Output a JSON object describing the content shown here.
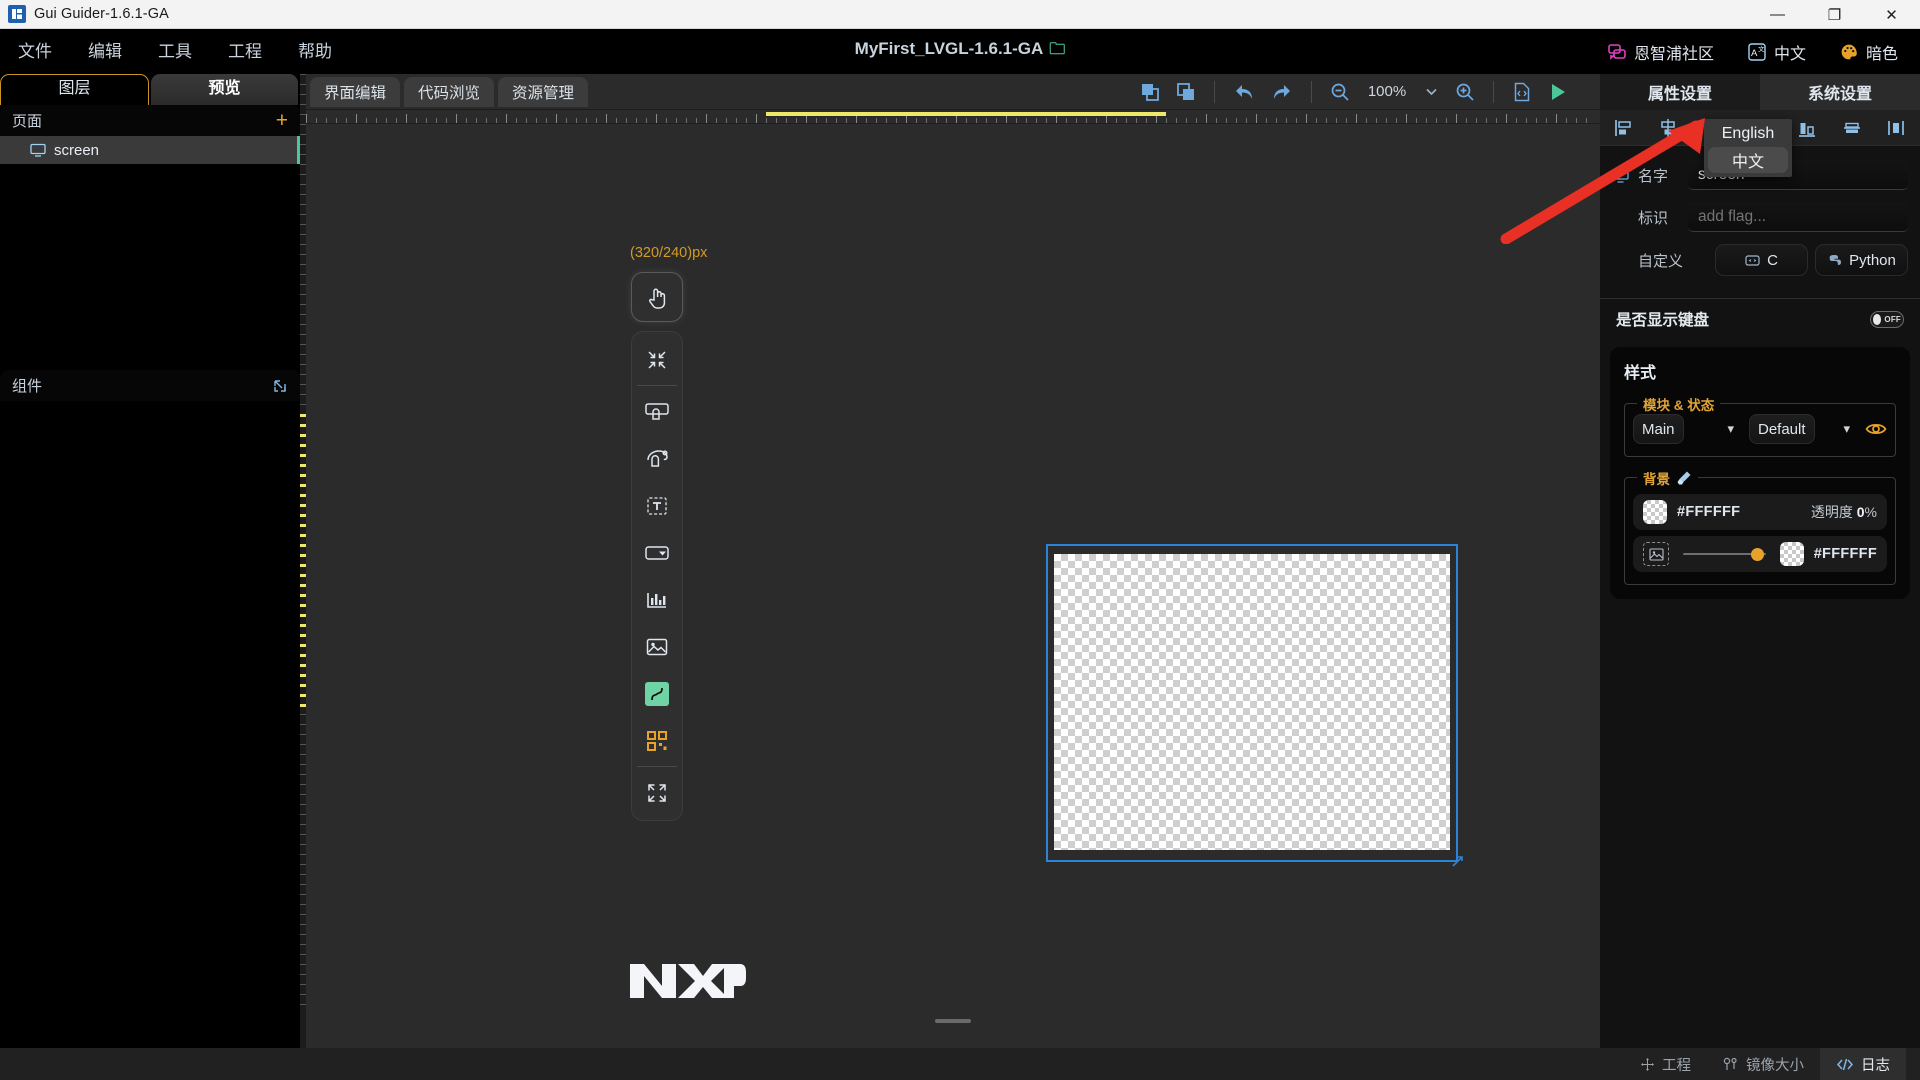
{
  "window": {
    "title": "Gui Guider-1.6.1-GA",
    "app_icon": "app-logo-icon",
    "controls": {
      "minimize": "—",
      "maximize": "❐",
      "close": "✕"
    }
  },
  "menubar": {
    "items": [
      {
        "label": "文件"
      },
      {
        "label": "编辑"
      },
      {
        "label": "工具"
      },
      {
        "label": "工程"
      },
      {
        "label": "帮助"
      }
    ],
    "project_title": "MyFirst_LVGL-1.6.1-GA",
    "folder_icon": "open-folder-icon",
    "right_items": [
      {
        "icon": "community-chat-icon",
        "label": "恩智浦社区"
      },
      {
        "icon": "translate-icon",
        "label": "中文"
      },
      {
        "icon": "palette-icon",
        "label": "暗色"
      }
    ]
  },
  "language_menu": {
    "options": [
      {
        "label": "English",
        "selected": false
      },
      {
        "label": "中文",
        "selected": true
      }
    ]
  },
  "left": {
    "tabs": [
      {
        "label": "图层",
        "active": true
      },
      {
        "label": "预览",
        "active": false
      }
    ],
    "pages_panel": {
      "title": "页面",
      "add_icon": "plus-icon",
      "items": [
        {
          "icon": "screen-monitor-icon",
          "label": "screen",
          "selected": true
        }
      ]
    },
    "components_panel": {
      "title": "组件",
      "expand_icon": "external-link-icon",
      "items": []
    }
  },
  "center": {
    "tabs": [
      {
        "label": "界面编辑",
        "active": true
      },
      {
        "label": "代码浏览",
        "active": false
      },
      {
        "label": "资源管理",
        "active": false
      }
    ],
    "toolbar": {
      "copy_label": "copy-layer-icon",
      "paste_label": "paste-layer-icon",
      "undo_label": "undo-icon",
      "redo_label": "redo-icon",
      "zoom_out": "zoom-out-icon",
      "zoom_value": "100%",
      "zoom_chevron": "chevron-down-icon",
      "zoom_in": "zoom-in-icon",
      "generate_code": "generate-code-icon",
      "run": "run-play-icon"
    },
    "canvas": {
      "dimension_label": "(320/240)px",
      "device_width": 320,
      "device_height": 240,
      "brand_logo": "NXP"
    },
    "palette": {
      "hand_tool": "hand-pointer-icon",
      "items": [
        {
          "icon": "collapse-arrows-icon"
        },
        {
          "icon": "container-widget-icon"
        },
        {
          "icon": "animation-widget-icon"
        },
        {
          "icon": "text-label-icon"
        },
        {
          "icon": "dropdown-widget-icon"
        },
        {
          "icon": "bar-chart-widget-icon"
        },
        {
          "icon": "image-widget-icon"
        },
        {
          "icon": "curve-widget-icon"
        },
        {
          "icon": "qrcode-widget-icon"
        },
        {
          "icon": "expand-arrows-icon"
        }
      ]
    }
  },
  "right": {
    "tabs": [
      {
        "label": "属性设置",
        "active": false
      },
      {
        "label": "系统设置",
        "active": true
      }
    ],
    "align_toolbar": [
      {
        "icon": "align-left-icon"
      },
      {
        "icon": "align-center-horizontal-icon"
      },
      {
        "icon": "distribute-bottom-icon"
      },
      {
        "icon": "align-middle-icon"
      },
      {
        "icon": "distribute-horizontal-icon"
      }
    ],
    "properties": {
      "name_label": "名字",
      "name_icon": "screen-monitor-icon",
      "name_value": "screen",
      "flag_label": "标识",
      "flag_value": "add flag...",
      "custom_label": "自定义",
      "custom_buttons": [
        {
          "icon": "c-lang-icon",
          "label": "C"
        },
        {
          "icon": "python-icon",
          "label": "Python"
        }
      ]
    },
    "keyboard_toggle": {
      "label": "是否显示键盘",
      "state": "OFF"
    },
    "style": {
      "title": "样式",
      "module_state": {
        "legend": "模块 & 状态",
        "module_value": "Main",
        "module_options": [
          "Main"
        ],
        "state_value": "Default",
        "state_options": [
          "Default"
        ],
        "eye_icon": "eye-visibility-icon"
      },
      "background": {
        "legend": "背景",
        "legend_icon": "brush-icon",
        "color_hex": "#FFFFFF",
        "opacity_label": "透明度",
        "opacity_value": "0",
        "opacity_unit": "%",
        "image_icon": "image-placeholder-icon",
        "gradient_hex": "#FFFFFF",
        "slider_percent": 82
      }
    }
  },
  "statusbar": {
    "items": [
      {
        "icon": "move-cross-icon",
        "label": "工程",
        "active": false
      },
      {
        "icon": "resize-image-icon",
        "label": "镜像大小",
        "active": false
      },
      {
        "icon": "code-brackets-icon",
        "label": "日志",
        "active": true
      }
    ]
  },
  "colors": {
    "accent_orange": "#e8a22a",
    "accent_green": "#4cc79a",
    "selection_blue": "#2b84d8",
    "annotation_red": "#e83025"
  }
}
